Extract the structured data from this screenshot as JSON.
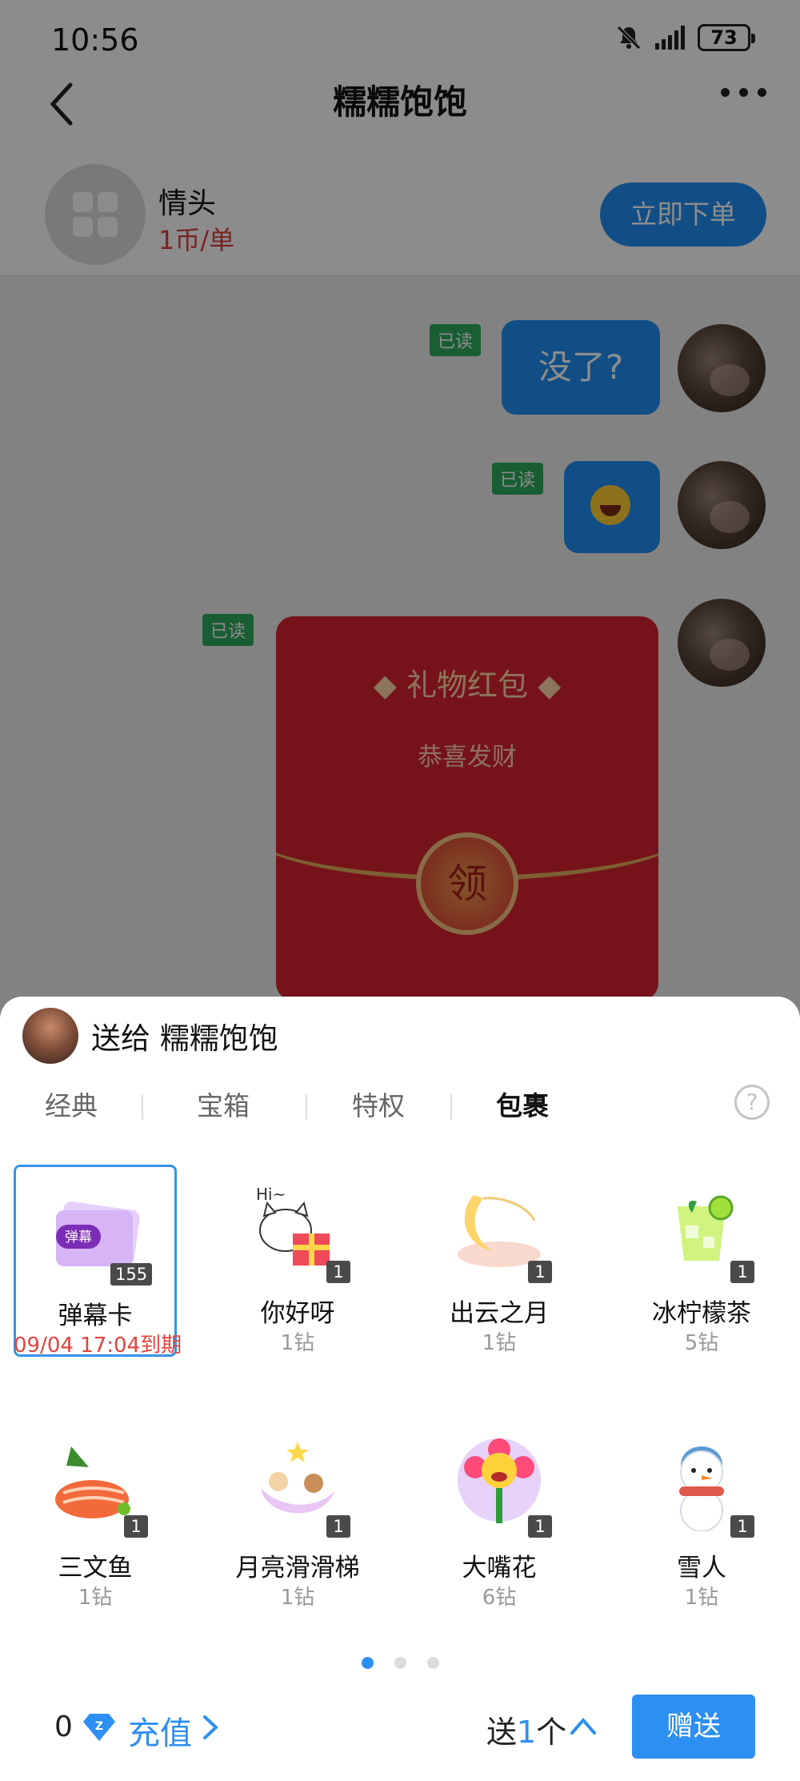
{
  "status_bar": {
    "time": "10:56",
    "battery": "73"
  },
  "nav": {
    "title": "糯糯饱饱"
  },
  "service": {
    "name": "情头",
    "price": "1币/单",
    "order_button": "立即下单"
  },
  "messages": [
    {
      "read": "已读",
      "text": "没了?"
    },
    {
      "read": "已读",
      "emoji": "laugh-cry-emoji"
    },
    {
      "read": "已读",
      "type": "red-packet",
      "title": "◆ 礼物红包 ◆",
      "subtitle": "恭喜发财",
      "button": "领"
    }
  ],
  "sheet": {
    "send_to": "送给 糯糯饱饱",
    "tabs": [
      "经典",
      "宝箱",
      "特权",
      "包裹"
    ],
    "active_tab": 3,
    "help": "?",
    "gifts": [
      {
        "name": "弹幕卡",
        "count": "155",
        "sub": "09/04 17:04到期",
        "icon": "danmu-card-icon",
        "selected": true
      },
      {
        "name": "你好呀",
        "count": "1",
        "sub": "1钻",
        "icon": "hello-cat-gift-icon"
      },
      {
        "name": "出云之月",
        "count": "1",
        "sub": "1钻",
        "icon": "crescent-moon-icon"
      },
      {
        "name": "冰柠檬茶",
        "count": "1",
        "sub": "5钻",
        "icon": "iced-lemon-tea-icon"
      },
      {
        "name": "三文鱼",
        "count": "1",
        "sub": "1钻",
        "icon": "salmon-icon"
      },
      {
        "name": "月亮滑滑梯",
        "count": "1",
        "sub": "1钻",
        "icon": "moon-slide-icon"
      },
      {
        "name": "大嘴花",
        "count": "1",
        "sub": "6钻",
        "icon": "big-mouth-flower-icon"
      },
      {
        "name": "雪人",
        "count": "1",
        "sub": "1钻",
        "icon": "snowman-icon"
      }
    ],
    "pages": 3,
    "current_page": 0,
    "balance": "0",
    "recharge": "充值",
    "qty_prefix": "送",
    "qty_num": "1",
    "qty_suffix": "个",
    "give_button": "赠送"
  },
  "colors": {
    "accent": "#2e8ff2",
    "expire": "#e2443d",
    "read_tag": "#2fa95b",
    "red_packet": "#d82331"
  }
}
